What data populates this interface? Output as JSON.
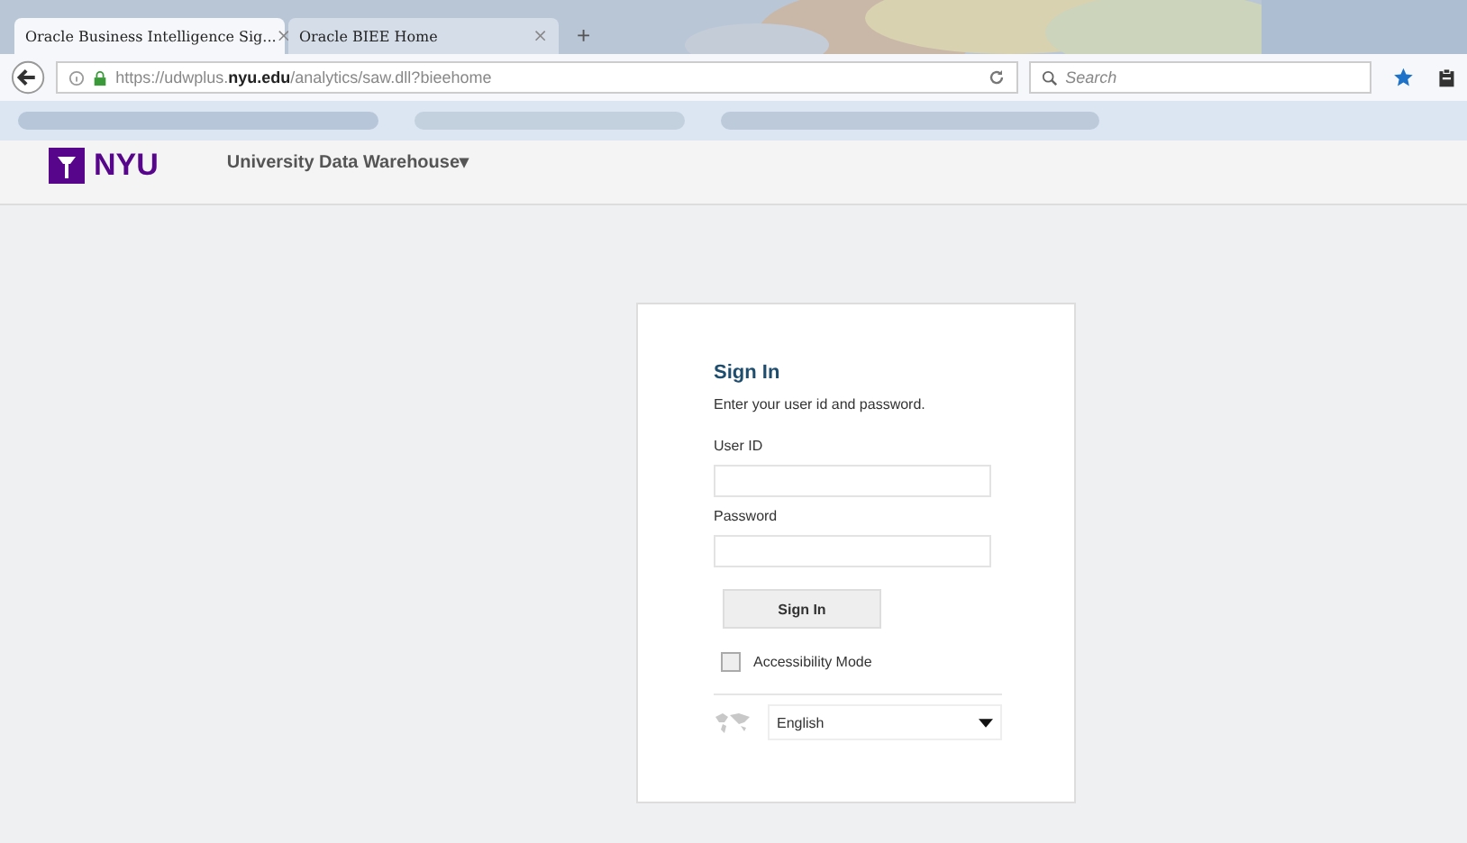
{
  "tabs": [
    {
      "label": "Oracle Business Intelligence Sig...",
      "close": "×",
      "selected": true
    },
    {
      "label": "Oracle BIEE Home",
      "close": "×",
      "selected": false
    }
  ],
  "new_tab": "+",
  "address_bar": {
    "url": "https://udwplus.**nyu.edu**/analytics/saw.dll?bieehome"
  },
  "search": {
    "placeholder": "Search"
  },
  "header": {
    "logo_text": "NYU",
    "app_menu": "University Data Warehouse▾"
  },
  "sign_in": {
    "title": "Sign In",
    "instructions": "Enter your user id and password.",
    "user_id_label": "User ID",
    "password_label": "Password",
    "button": "Sign In",
    "accessibility": {
      "label": "Accessibility Mode",
      "checked": false
    },
    "language": "English"
  }
}
